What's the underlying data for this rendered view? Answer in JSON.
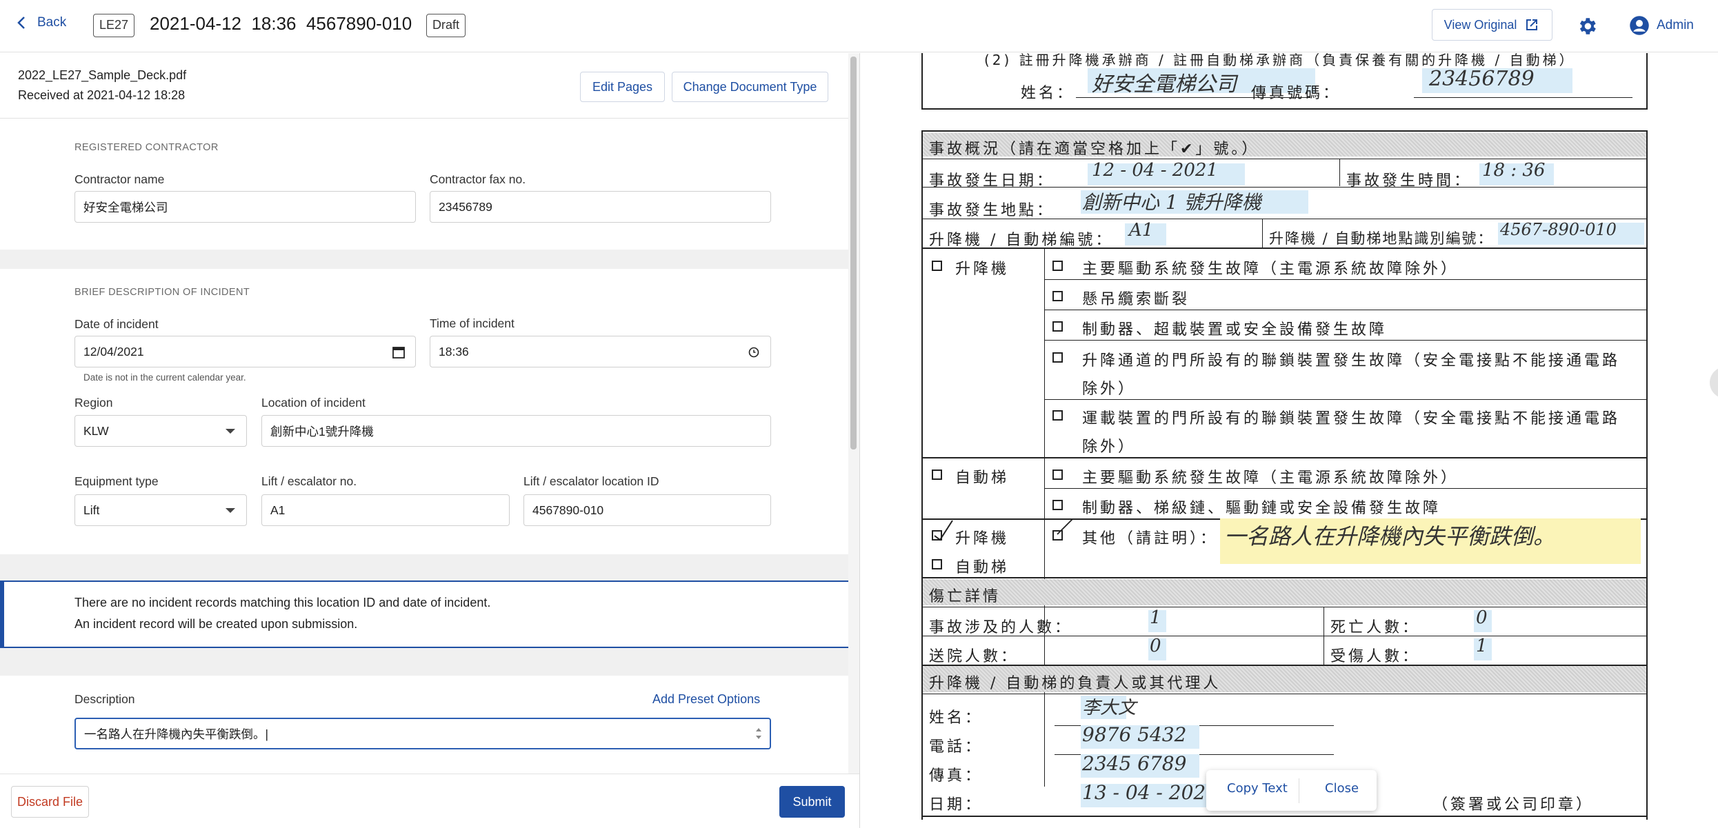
{
  "header": {
    "back_label": "Back",
    "form_code": "LE27",
    "title": "2021-04-12  18:36  4567890-010",
    "status": "Draft",
    "view_original_label": "View Original",
    "user_name": "Admin"
  },
  "file": {
    "name": "2022_LE27_Sample_Deck.pdf",
    "received": "Received at 2021-04-12 18:28",
    "edit_pages_label": "Edit Pages",
    "change_type_label": "Change Document Type"
  },
  "contractor": {
    "section_title": "REGISTERED CONTRACTOR",
    "name_label": "Contractor name",
    "name_value": "好安全電梯公司",
    "fax_label": "Contractor fax no.",
    "fax_value": "23456789"
  },
  "incident": {
    "section_title": "BRIEF DESCRIPTION OF INCIDENT",
    "date_label": "Date of incident",
    "date_value": "12/04/2021",
    "date_hint": "Date is not in the current calendar year.",
    "time_label": "Time of incident",
    "time_value": "18:36",
    "region_label": "Region",
    "region_value": "KLW",
    "location_label": "Location of incident",
    "location_value": "創新中心1號升降機",
    "equipment_label": "Equipment type",
    "equipment_value": "Lift",
    "lift_no_label": "Lift / escalator no.",
    "lift_no_value": "A1",
    "location_id_label": "Lift / escalator location ID",
    "location_id_value": "4567890-010"
  },
  "notice": {
    "line1": "There are no incident records matching this location ID and date of incident.",
    "line2": "An incident record will be created upon submission."
  },
  "description": {
    "label": "Description",
    "add_preset_label": "Add Preset Options",
    "value": "一名路人在升降機內失平衡跌倒。|"
  },
  "actions": {
    "discard_label": "Discard File",
    "submit_label": "Submit"
  },
  "document": {
    "top_caption": "(2)  註冊升降機承辦商 / 註冊自動梯承辦商（負責保養有關的升降機 / 自動梯）",
    "name_label": "姓名：",
    "name_hw": "好安全電梯公司",
    "fax_label": "傳真號碼：",
    "fax_hw": "23456789",
    "overview_header": "事故概況（請在適當空格加上「✔」號。）",
    "date_label": "事故發生日期：",
    "date_hw": "12 - 04 - 2021",
    "time_label": "事故發生時間：",
    "time_hw": "18 : 36",
    "place_label": "事故發生地點：",
    "place_hw": "創新中心 1 號升降機",
    "equip_no_label": "升降機 / 自動梯編號：",
    "equip_no_hw": "A1",
    "loc_id_label": "升降機 / 自動梯地點識別編號：",
    "loc_id_hw": "4567-890-010",
    "lift": "升降機",
    "escalator": "自動梯",
    "lift_items": [
      "主要驅動系統發生故障（主電源系統故障除外）",
      "懸吊纜索斷裂",
      "制動器、超載裝置或安全設備發生故障",
      "升降通道的門所設有的聯鎖裝置發生故障（安全電接點不能接通電路",
      "除外）",
      "運載裝置的門所設有的聯鎖裝置發生故障（安全電接點不能接通電路",
      "除外）"
    ],
    "esc_items": [
      "主要驅動系統發生故障（主電源系統故障除外）",
      "制動器、梯級鏈、驅動鏈或安全設備發生故障"
    ],
    "other_label": "其他（請註明）：",
    "other_hw": "一名路人在升降機內失平衡跌倒。",
    "casualty_header": "傷亡詳情",
    "involved_label": "事故涉及的人數：",
    "involved_hw": "1",
    "dead_label": "死亡人數：",
    "dead_hw": "0",
    "hospital_label": "送院人數：",
    "hospital_hw": "0",
    "injured_label": "受傷人數：",
    "injured_hw": "1",
    "responsible_header": "升降機 / 自動梯的負責人或其代理人",
    "resp_name_label": "姓名：",
    "resp_name_hw": "李大文",
    "phone_label": "電話：",
    "phone_hw": "9876 5432",
    "fax2_label": "傳真：",
    "fax2_hw": "2345 6789",
    "date2_label": "日期：",
    "date2_hw": "13 - 04 - 202",
    "signature_label": "（簽署或公司印章）",
    "copy_text_label": "Copy Text",
    "close_label": "Close"
  },
  "colors": {
    "accent": "#1f4fa3",
    "danger": "#c23b22",
    "highlight_blue": "#d9ecf8",
    "highlight_yellow": "#fbf4b8"
  }
}
